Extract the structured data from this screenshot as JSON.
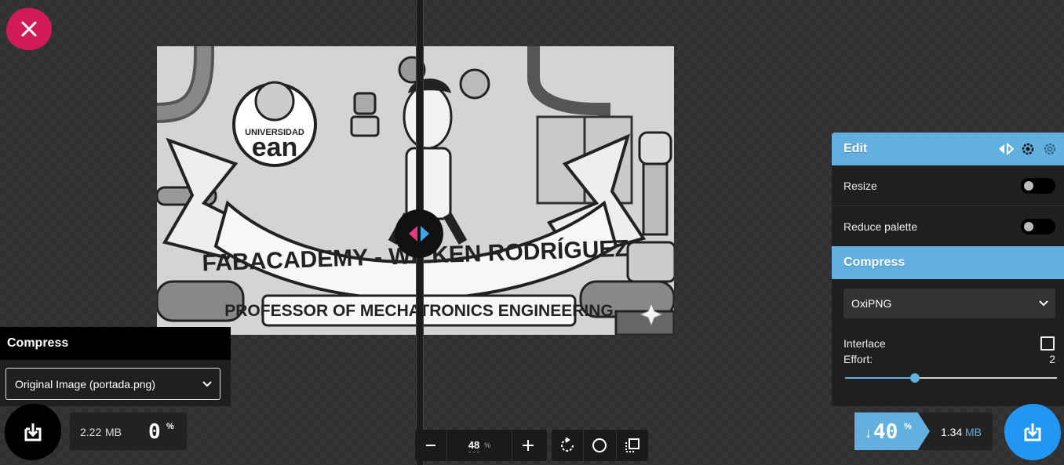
{
  "close": {
    "icon": "close-icon"
  },
  "image": {
    "banner_text": "FABACADEMY - WILKEN RODRÍGUEZ",
    "subtitle_text": "PROFESSOR OF MECHATRONICS ENGINEERING",
    "logo_top": "UNIVERSIDAD",
    "logo_main": "ean",
    "logo_mark": "®"
  },
  "left_panel": {
    "title": "Compress",
    "select_value": "Original Image (portada.png)",
    "size_value": "2.22",
    "size_unit": "MB",
    "percent": "0",
    "percent_sign": "%"
  },
  "zoom": {
    "value": "48",
    "unit": "%",
    "minus": "−",
    "plus": "+"
  },
  "right_panel": {
    "edit_title": "Edit",
    "resize_label": "Resize",
    "reduce_palette_label": "Reduce palette",
    "compress_title": "Compress",
    "codec_value": "OxiPNG",
    "interlace_label": "Interlace",
    "effort_label": "Effort:",
    "effort_value": "2",
    "effort_fraction": 0.33,
    "percent_arrow": "↓",
    "percent": "40",
    "percent_sign": "%",
    "size_value": "1.34",
    "size_unit": "MB"
  },
  "colors": {
    "accent_blue": "#62b0e0",
    "close_pink": "#d21a5b",
    "download_blue": "#2196f3"
  }
}
